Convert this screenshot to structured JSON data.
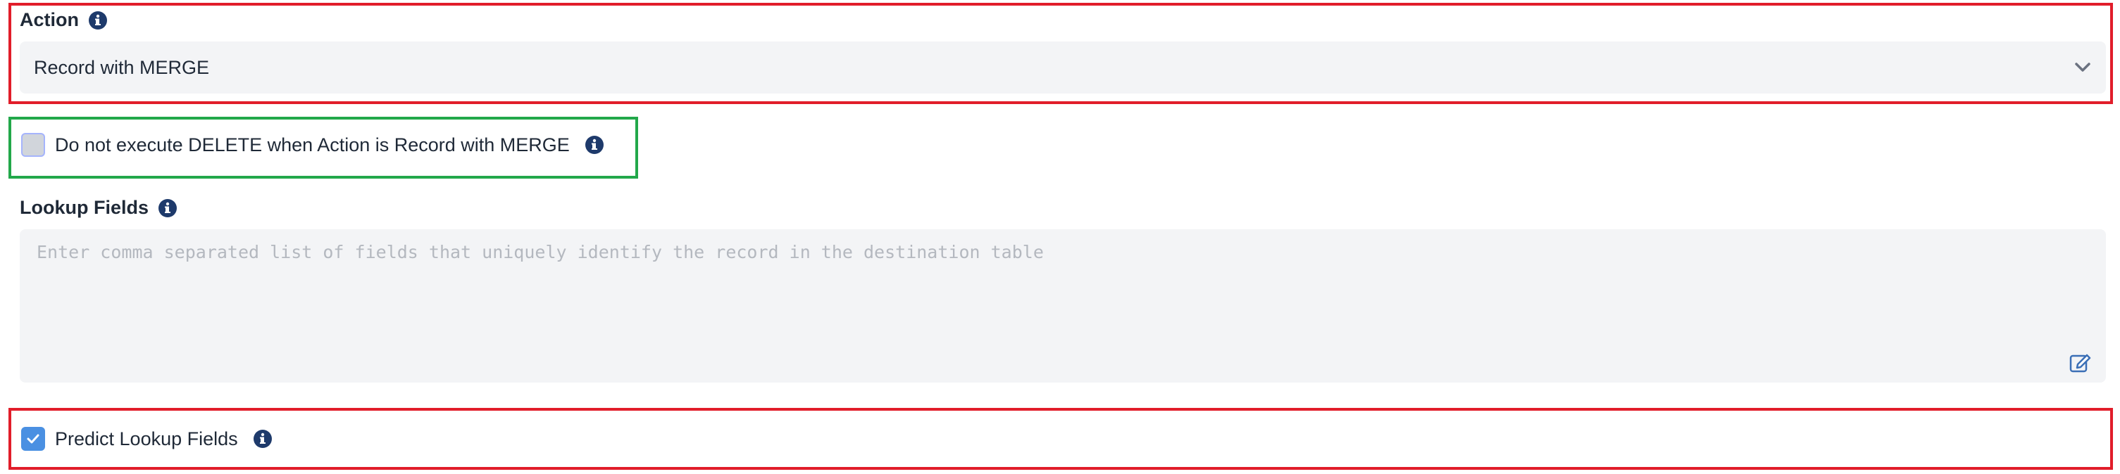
{
  "action": {
    "label": "Action",
    "selected": "Record with MERGE"
  },
  "no_delete": {
    "label": "Do not execute DELETE when Action is Record with MERGE",
    "checked": false
  },
  "lookup": {
    "label": "Lookup Fields",
    "placeholder": "Enter comma separated list of fields that uniquely identify the record in the destination table",
    "value": ""
  },
  "predict": {
    "label": "Predict Lookup Fields",
    "checked": true
  },
  "icons": {
    "info": "info-icon",
    "chevron": "chevron-down-icon",
    "edit": "edit-icon",
    "check": "check-icon"
  },
  "colors": {
    "info_icon": "#1e3a6b",
    "checkbox_checked": "#4a90e2",
    "field_bg": "#f3f4f6",
    "annot_red": "#e11d2a",
    "annot_green": "#22a84a"
  }
}
